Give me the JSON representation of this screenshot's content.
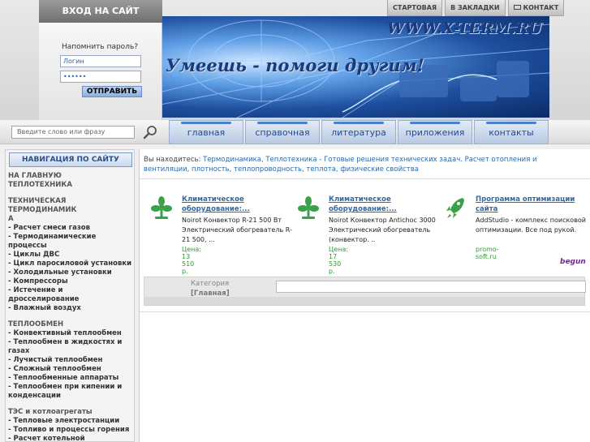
{
  "header": {
    "login_title": "ВХОД НА САЙТ",
    "remind_password": "Напомнить пароль?",
    "login_placeholder": "Логин",
    "password_value": "••••••",
    "submit_label": "ОТПРАВИТЬ",
    "site_url": "WWW.X-TERM.RU",
    "slogan": "Умеешь - помоги другим!",
    "top_links": [
      "СТАРТОВАЯ",
      "В ЗАКЛАДКИ",
      "КОНТАКТ"
    ]
  },
  "search": {
    "placeholder": "Введите слово или фразу"
  },
  "menu": [
    "главная",
    "справочная",
    "литература",
    "приложения",
    "контакты"
  ],
  "sidebar": {
    "title": "НАВИГАЦИЯ ПО САЙТУ",
    "groups": [
      [
        "НА ГЛАВНУЮ",
        "ТЕПЛОТЕХНИКА"
      ],
      [
        "ТЕХНИЧЕСКАЯ ТЕРМОДИНАМИК",
        "А",
        "- Расчет смеси газов",
        "- Термодинамические процессы",
        "- Циклы ДВС",
        "- Цикл паросиловой установки",
        "- Холодильные установки",
        "- Компрессоры",
        "- Истечение и дросселирование",
        "- Влажный воздух"
      ],
      [
        "ТЕПЛООБМЕН",
        "- Конвективный теплообмен",
        "- Теплообмен в жидкостях и",
        "газах",
        "- Лучистый теплообмен",
        "- Сложный теплообмен",
        "- Теплообменные аппараты",
        "- Теплообмен при кипении и",
        "конденсации"
      ],
      [
        "ТЭС и котлоагрегаты",
        "- Тепловые электростанции",
        "- Топливо и процессы горения",
        "- Расчет котельной"
      ]
    ]
  },
  "breadcrumb": {
    "label": "Вы находитесь:",
    "text": "Термодинамика, Теплотехника - Готовые решения технических задач. Расчет отопления и вентиляции, плотность, теплопроводность, теплота, физические свойства"
  },
  "ads": [
    {
      "title": "Климатическое оборудование:...",
      "desc": "Noirot Конвектор R-21 500 Вт Электрический обогреватель R-21 500, ...",
      "price": "Цена: 13 510 р.",
      "icon": "fan-icon"
    },
    {
      "title": "Климатическое оборудование:...",
      "desc": "Noirot Конвектор Antichoc 3000 Электрический обогреватель (конвектор. ..",
      "price": "Цена: 17 530 р.",
      "icon": "fan-icon"
    },
    {
      "title": "Программа оптимизации сайта",
      "desc": "AddStudio - комплекс поисковой оптимизации. Все под рукой.",
      "price": "promo-soft.ru",
      "icon": "rocket-icon"
    }
  ],
  "ads_brand": "begun",
  "category": {
    "label": "Категория",
    "value": "[Главная]"
  }
}
